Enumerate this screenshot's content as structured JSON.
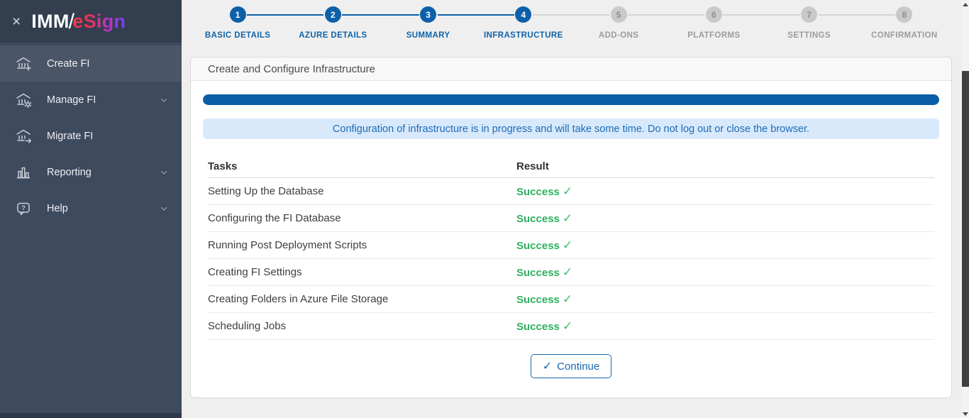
{
  "app": {
    "title": "IMM eSign"
  },
  "colors": {
    "sidebar_bg": "#3e4a5e",
    "sidebar_header_bg": "#333e4f",
    "sidebar_active_bg": "#4b5568",
    "accent_blue": "#0d60a8",
    "step_pending_gray": "#c9c9c9",
    "progress_blue": "#0b5da6",
    "info_bg": "#d8e9fb",
    "info_text": "#1d6cb5",
    "success_green": "#2eb05f",
    "button_blue": "#1668b0",
    "logo_gradient_start": "#f23d4c",
    "logo_gradient_end": "#6f42f5"
  },
  "sidebar": {
    "close_icon": "×",
    "logo": {
      "imm": "IMM",
      "slash": "/",
      "esign": "eSign"
    },
    "items": [
      {
        "label": "Create FI",
        "icon": "bank-plus-icon",
        "active": true,
        "chevron": false
      },
      {
        "label": "Manage FI",
        "icon": "bank-gear-icon",
        "active": false,
        "chevron": true
      },
      {
        "label": "Migrate FI",
        "icon": "bank-arrow-icon",
        "active": false,
        "chevron": false
      },
      {
        "label": "Reporting",
        "icon": "bar-chart-icon",
        "active": false,
        "chevron": true
      },
      {
        "label": "Help",
        "icon": "help-bubble-icon",
        "active": false,
        "chevron": true
      }
    ]
  },
  "stepper": {
    "current_step": 4,
    "steps": [
      {
        "number": "1",
        "label": "BASIC DETAILS",
        "state": "active"
      },
      {
        "number": "2",
        "label": "AZURE DETAILS",
        "state": "active"
      },
      {
        "number": "3",
        "label": "SUMMARY",
        "state": "active"
      },
      {
        "number": "4",
        "label": "INFRASTRUCTURE",
        "state": "active"
      },
      {
        "number": "5",
        "label": "ADD-ONS",
        "state": "pending"
      },
      {
        "number": "6",
        "label": "PLATFORMS",
        "state": "pending"
      },
      {
        "number": "7",
        "label": "SETTINGS",
        "state": "pending"
      },
      {
        "number": "8",
        "label": "CONFIRMATION",
        "state": "pending"
      }
    ]
  },
  "panel": {
    "title": "Create and Configure Infrastructure",
    "progress_percent": 100,
    "info_message": "Configuration of infrastructure is in progress and will take some time. Do not log out or close the browser.",
    "table": {
      "columns": [
        {
          "label": "Tasks"
        },
        {
          "label": "Result"
        }
      ],
      "check_icon": "✓",
      "rows": [
        {
          "task": "Setting Up the Database",
          "result": "Success"
        },
        {
          "task": "Configuring the FI Database",
          "result": "Success"
        },
        {
          "task": "Running Post Deployment Scripts",
          "result": "Success"
        },
        {
          "task": "Creating FI Settings",
          "result": "Success"
        },
        {
          "task": "Creating Folders in Azure File Storage",
          "result": "Success"
        },
        {
          "task": "Scheduling Jobs",
          "result": "Success"
        }
      ]
    },
    "continue_button": {
      "icon": "✓",
      "label": "Continue"
    }
  },
  "scrollbar": {
    "up_icon": "▲",
    "down_icon": "▼"
  }
}
